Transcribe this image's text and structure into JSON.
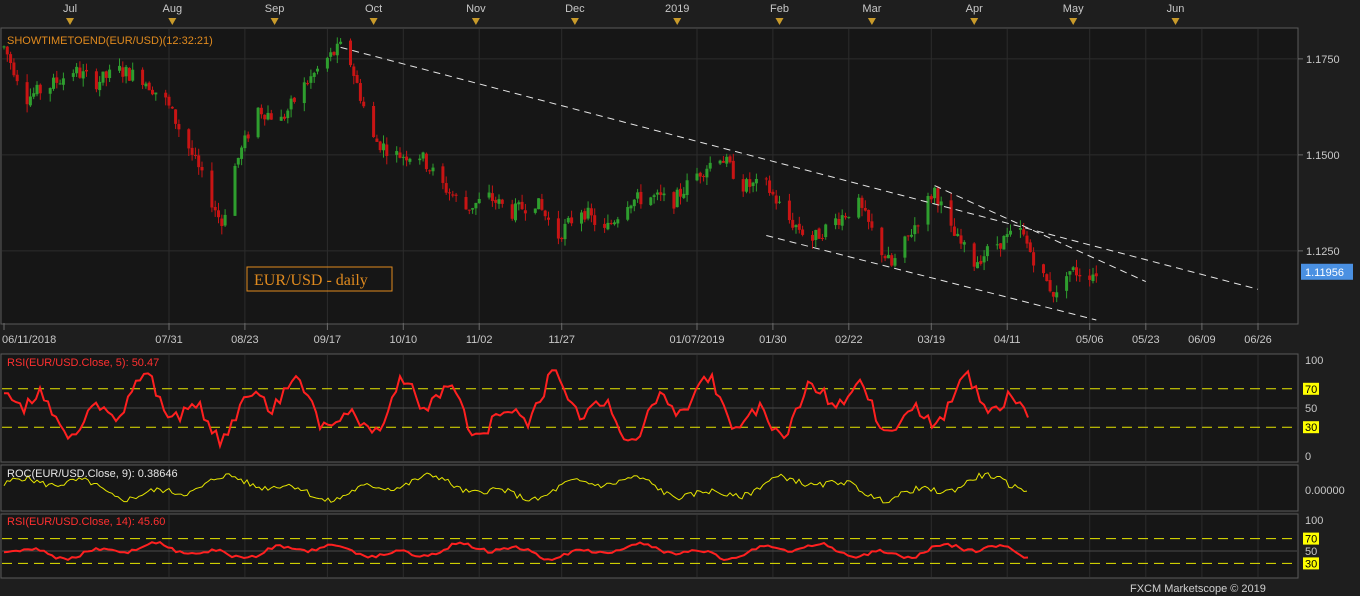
{
  "colors": {
    "background": "#1e1e1e",
    "panel": "#161616",
    "grid": "#2c2c2c",
    "border": "#5a5a5a",
    "text": "#c8c8c8",
    "up_candle": "#2e9e2e",
    "down_candle": "#c81414",
    "trendline": "#e6e6e6",
    "price_tag": "#4a90e2",
    "orange": "#e08a1e",
    "rsi_line": "#ff2020",
    "roc_line": "#e6e600",
    "level_line": "#e6e600",
    "level_tag": "#ffff00",
    "title_box_border": "#e08a1e"
  },
  "month_markers": [
    "Jul",
    "Aug",
    "Sep",
    "Oct",
    "Nov",
    "Dec",
    "2019",
    "Feb",
    "Mar",
    "Apr",
    "May",
    "Jun"
  ],
  "date_axis": [
    "06/11/2018",
    "07/31",
    "08/23",
    "09/17",
    "10/10",
    "11/02",
    "11/27",
    "01/07/2019",
    "01/30",
    "02/22",
    "03/19",
    "04/11",
    "05/06",
    "05/23",
    "06/09",
    "06/26"
  ],
  "price_panel": {
    "indicator_label": "SHOWTIMETOEND(EUR/USD)(12:32:21)",
    "title": "EUR/USD - daily",
    "y_ticks": [
      "1.1750",
      "1.1500",
      "1.1250"
    ],
    "current_price": "1.11956"
  },
  "rsi5_panel": {
    "label": "RSI(EUR/USD.Close, 5): 50.47",
    "scale": [
      "100",
      "70",
      "50",
      "30",
      "0"
    ]
  },
  "roc_panel": {
    "label": "ROC(EUR/USD.Close, 9): 0.38646",
    "scale": [
      "0.00000"
    ]
  },
  "rsi14_panel": {
    "label": "RSI(EUR/USD.Close, 14): 45.60",
    "scale": [
      "100",
      "70",
      "50",
      "30"
    ]
  },
  "footer": "FXCM Marketscope © 2019",
  "chart_data": {
    "type": "candlestick",
    "symbol": "EUR/USD",
    "timeframe": "daily",
    "x_range": [
      "2018-06-11",
      "2019-06-26"
    ],
    "y_range": [
      1.107,
      1.182
    ],
    "ohlc_close_path": {
      "dates": [
        "2018-06-11",
        "2018-06-18",
        "2018-06-25",
        "2018-07-02",
        "2018-07-09",
        "2018-07-16",
        "2018-07-23",
        "2018-07-30",
        "2018-08-06",
        "2018-08-13",
        "2018-08-16",
        "2018-08-20",
        "2018-08-27",
        "2018-09-03",
        "2018-09-10",
        "2018-09-17",
        "2018-09-21",
        "2018-09-24",
        "2018-10-01",
        "2018-10-08",
        "2018-10-15",
        "2018-10-22",
        "2018-10-29",
        "2018-11-05",
        "2018-11-12",
        "2018-11-19",
        "2018-11-26",
        "2018-12-03",
        "2018-12-10",
        "2018-12-17",
        "2018-12-24",
        "2018-12-31",
        "2019-01-07",
        "2019-01-14",
        "2019-01-21",
        "2019-01-28",
        "2019-02-04",
        "2019-02-11",
        "2019-02-18",
        "2019-02-25",
        "2019-03-04",
        "2019-03-07",
        "2019-03-11",
        "2019-03-18",
        "2019-03-20",
        "2019-03-25",
        "2019-04-01",
        "2019-04-08",
        "2019-04-15",
        "2019-04-22",
        "2019-04-26",
        "2019-04-29",
        "2019-05-06",
        "2019-05-08"
      ],
      "close": [
        1.178,
        1.165,
        1.168,
        1.172,
        1.169,
        1.172,
        1.17,
        1.164,
        1.152,
        1.138,
        1.132,
        1.147,
        1.162,
        1.159,
        1.168,
        1.175,
        1.178,
        1.174,
        1.154,
        1.15,
        1.15,
        1.142,
        1.136,
        1.139,
        1.135,
        1.138,
        1.129,
        1.136,
        1.13,
        1.138,
        1.139,
        1.138,
        1.145,
        1.15,
        1.142,
        1.142,
        1.133,
        1.128,
        1.133,
        1.137,
        1.125,
        1.121,
        1.127,
        1.138,
        1.141,
        1.13,
        1.122,
        1.127,
        1.13,
        1.118,
        1.113,
        1.12,
        1.119,
        1.1196
      ]
    },
    "trendlines": [
      {
        "name": "upper-long",
        "from": [
          "2018-09-21",
          1.178
        ],
        "to": [
          "2019-06-26",
          1.115
        ]
      },
      {
        "name": "mid-short",
        "from": [
          "2019-03-20",
          1.142
        ],
        "to": [
          "2019-05-23",
          1.117
        ]
      },
      {
        "name": "channel-lower",
        "from": [
          "2019-01-28",
          1.129
        ],
        "to": [
          "2019-05-08",
          1.107
        ]
      }
    ],
    "rsi5_levels": [
      70,
      50,
      30
    ],
    "rsi14_levels": [
      70,
      50,
      30
    ]
  }
}
